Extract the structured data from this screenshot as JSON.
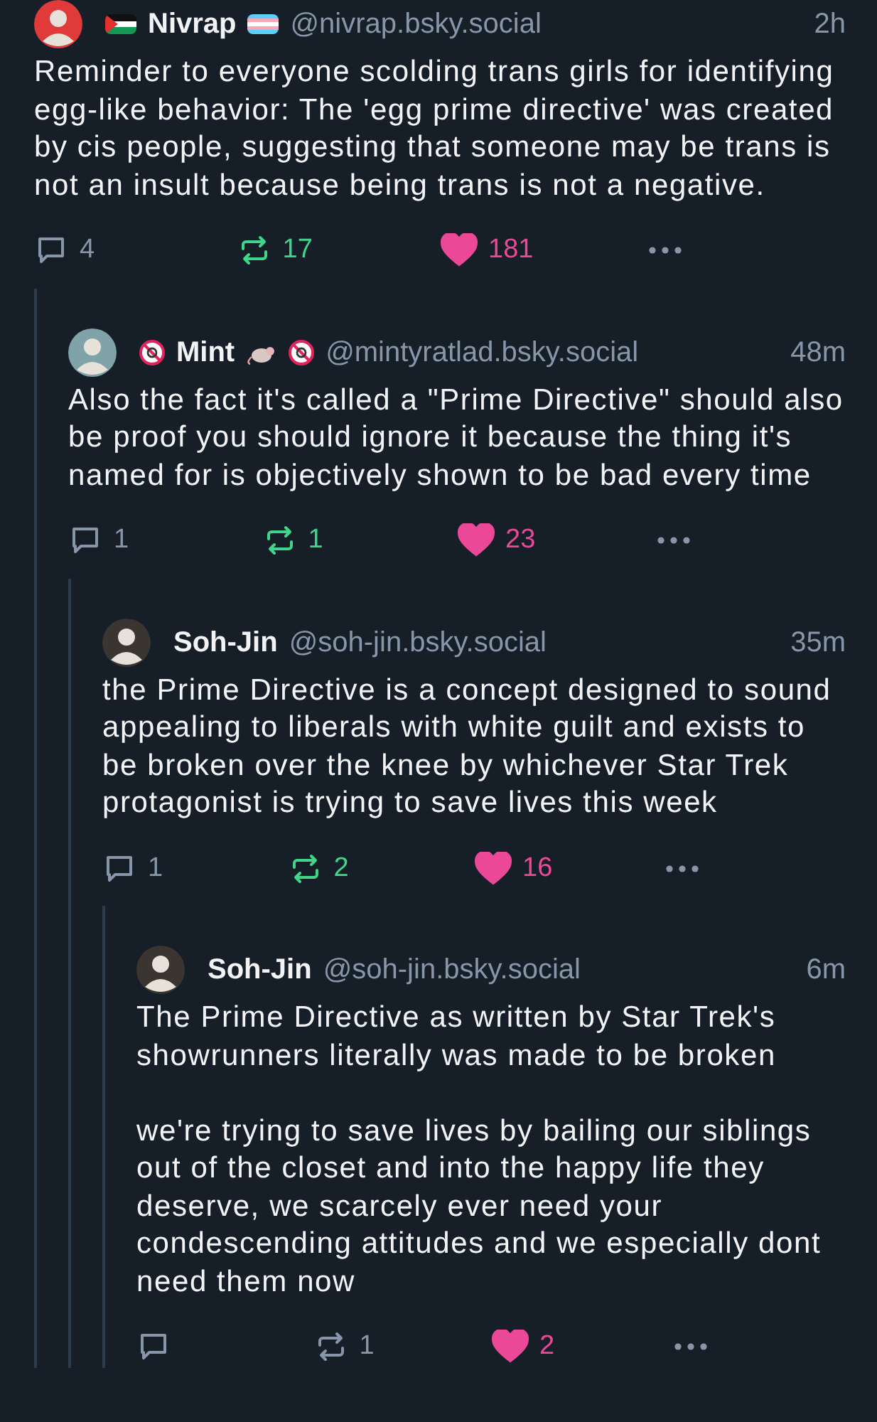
{
  "post": {
    "display_name": "Nivrap",
    "badges_before": [
      {
        "kind": "palestine-flag"
      }
    ],
    "badges_after": [
      {
        "kind": "trans-flag"
      }
    ],
    "handle": "@nivrap.bsky.social",
    "time": "2h",
    "text": "Reminder to everyone scolding trans girls for identifying egg-like behavior: The 'egg prime directive' was created by cis people, suggesting that someone may be trans is not an insult because being trans is not a negative.",
    "replies_count": "4",
    "reposts": "17",
    "reposted": true,
    "likes": "181",
    "liked": true,
    "replies": [
      {
        "display_name": "Mint",
        "badges_before": [
          {
            "kind": "no-minors"
          }
        ],
        "badges_after": [
          {
            "kind": "rat"
          },
          {
            "kind": "no-minors"
          }
        ],
        "handle": "@mintyratlad.bsky.social",
        "time": "48m",
        "text": "Also the fact it's called a \"Prime Directive\" should also be proof you should ignore it because the thing it's named for is objectively shown to be bad every time",
        "replies_count": "1",
        "reposts": "1",
        "reposted": true,
        "likes": "23",
        "liked": true,
        "replies": [
          {
            "display_name": "Soh-Jin",
            "handle": "@soh-jin.bsky.social",
            "time": "35m",
            "text": "the Prime Directive is a concept designed to sound appealing to liberals with white guilt and exists to be broken over the knee by whichever Star Trek protagonist is trying to save lives this week",
            "replies_count": "1",
            "reposts": "2",
            "reposted": true,
            "likes": "16",
            "liked": true,
            "replies": [
              {
                "display_name": "Soh-Jin",
                "handle": "@soh-jin.bsky.social",
                "time": "6m",
                "text": "The Prime Directive as written by Star Trek's showrunners literally was made to be broken\n\nwe're trying to save lives by bailing our siblings out of the closet and into the happy life they deserve, we scarcely ever need your condescending attitudes and we especially dont need them now",
                "reposts": "1",
                "reposted": false,
                "likes": "2",
                "liked": true
              }
            ]
          }
        ]
      }
    ]
  }
}
